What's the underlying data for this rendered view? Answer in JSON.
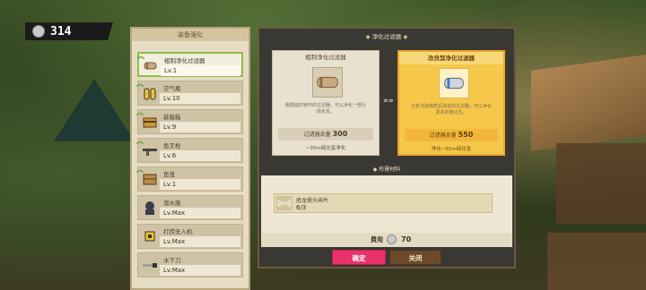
{
  "currency": {
    "value": "314",
    "icon": "gear-coin-icon"
  },
  "left_panel": {
    "title": "装备强化",
    "items": [
      {
        "name": "粗制净化过滤器",
        "level": "Lv.1",
        "icon": "filter-icon",
        "upgradable": true,
        "active": true
      },
      {
        "name": "空气瓶",
        "level": "Lv.10",
        "icon": "air-tank-icon",
        "upgradable": true,
        "active": false
      },
      {
        "name": "装箱箱",
        "level": "Lv.9",
        "icon": "box-icon",
        "upgradable": true,
        "active": false
      },
      {
        "name": "鱼叉枪",
        "level": "Lv.6",
        "icon": "harpoon-gun-icon",
        "upgradable": true,
        "active": false
      },
      {
        "name": "鱼笼",
        "level": "Lv.1",
        "icon": "fish-trap-icon",
        "upgradable": true,
        "active": false
      },
      {
        "name": "潜水服",
        "level": "Lv.Max",
        "icon": "diving-suit-icon",
        "upgradable": false,
        "active": false
      },
      {
        "name": "打捞无人机",
        "level": "Lv.Max",
        "icon": "drone-icon",
        "upgradable": false,
        "active": false
      },
      {
        "name": "水下刀",
        "level": "Lv.Max",
        "icon": "knife-icon",
        "upgradable": false,
        "active": false
      }
    ]
  },
  "main_panel": {
    "title": "净化过滤器",
    "current": {
      "name": "粗制净化过滤器",
      "desc": "粗糙临时制作的过滤器，可以净化一部分硫化氢。",
      "stat_label": "过滤器余量",
      "stat_value": "300",
      "sub": "~35m硫化氢净化"
    },
    "next": {
      "name": "改良型净化过滤器",
      "desc": "分析污染物质后改进的过滤器，可以净化更多的硫化氢。",
      "stat_label": "过滤器余量",
      "stat_value": "550",
      "sub": "净化~55m硫化氢"
    },
    "arrow": "»»",
    "materials_title": "所需材料",
    "material": {
      "name": "恐龙骨头碎片",
      "count": "6/3",
      "icon": "bone-icon"
    },
    "cost_label": "费用",
    "cost_value": "70",
    "confirm": "确定",
    "close": "关闭"
  },
  "colors": {
    "accent_confirm": "#e8336d",
    "highlight": "#f6c84a",
    "active_border": "#8cbf48"
  }
}
